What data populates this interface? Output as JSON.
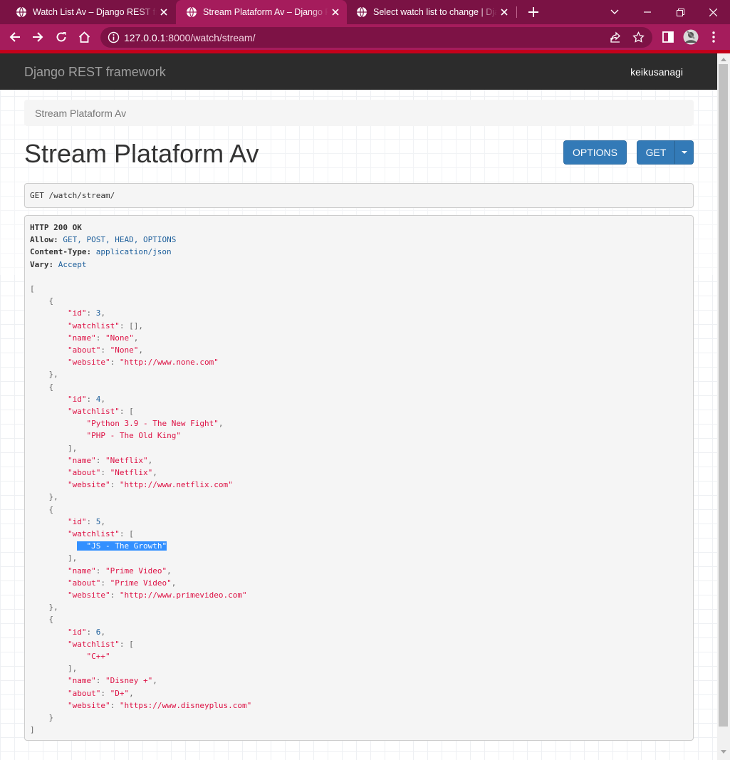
{
  "browser": {
    "tabs": [
      {
        "title": "Watch List Av – Django REST framework",
        "active": false
      },
      {
        "title": "Stream Plataform Av – Django REST framework",
        "active": true
      },
      {
        "title": "Select watch list to change | Django site admin",
        "active": false
      }
    ],
    "url_host": "127.0.0.1",
    "url_rest": ":8000/watch/stream/",
    "theme_color": "#a51c5c"
  },
  "page": {
    "brand": "Django REST framework",
    "user": "keikusanagi",
    "breadcrumb": "Stream Plataform Av",
    "title": "Stream Plataform Av",
    "options_label": "OPTIONS",
    "get_label": "GET",
    "request": {
      "method": "GET",
      "path": "/watch/stream/"
    }
  },
  "response": {
    "status": "HTTP 200 OK",
    "headers": [
      {
        "key": "Allow:",
        "value": "GET, POST, HEAD, OPTIONS"
      },
      {
        "key": "Content-Type:",
        "value": "application/json"
      },
      {
        "key": "Vary:",
        "value": "Accept"
      }
    ],
    "items": [
      {
        "id": "3",
        "watchlist": [],
        "name": "\"None\"",
        "about": "\"None\"",
        "website": "\"http://www.none.com\""
      },
      {
        "id": "4",
        "watchlist": [
          "\"Python 3.9 - The New Fight\"",
          "\"PHP - The Old King\""
        ],
        "name": "\"Netflix\"",
        "about": "\"Netflix\"",
        "website": "\"http://www.netflix.com\""
      },
      {
        "id": "5",
        "watchlist": [
          "\"JS - The Growth\""
        ],
        "name": "\"Prime Video\"",
        "about": "\"Prime Video\"",
        "website": "\"http://www.primevideo.com\""
      },
      {
        "id": "6",
        "watchlist": [
          "\"C++\""
        ],
        "name": "\"Disney +\"",
        "about": "\"D+\"",
        "website": "\"https://www.disneyplus.com\""
      }
    ],
    "keys": {
      "id": "\"id\"",
      "watchlist": "\"watchlist\"",
      "name": "\"name\"",
      "about": "\"about\"",
      "website": "\"website\""
    },
    "selected_text": "\"JS - The Growth\""
  }
}
